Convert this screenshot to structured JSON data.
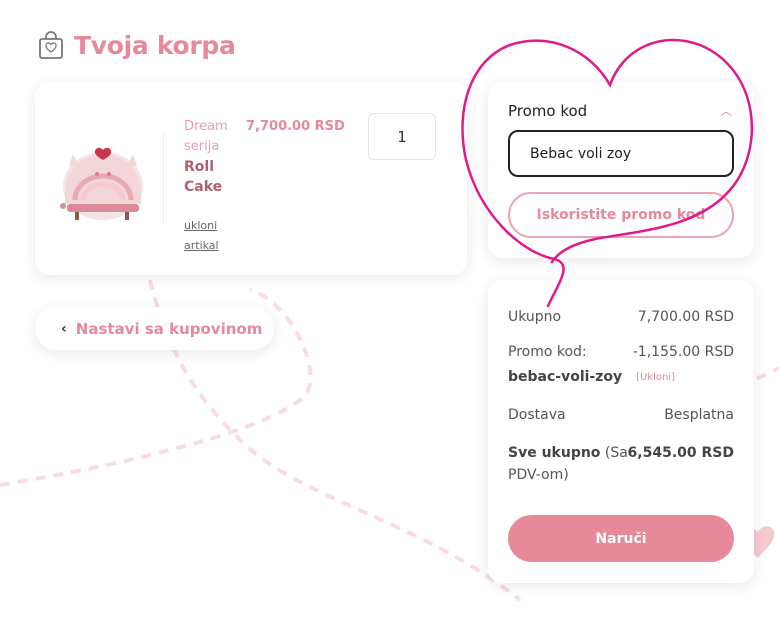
{
  "page": {
    "title": "Tvoja korpa"
  },
  "cart": {
    "items": [
      {
        "series": "Dream serija",
        "name": "Roll Cake",
        "remove_label": "ukloni artikal",
        "price": "7,700.00 RSD",
        "quantity": "1"
      }
    ],
    "continue_label": "Nastavi sa kupovinom"
  },
  "promo": {
    "title": "Promo kod",
    "input_value": "Bebac voli zoy",
    "apply_label": "Iskoristite promo kod"
  },
  "summary": {
    "subtotal_label": "Ukupno",
    "subtotal_value": "7,700.00 RSD",
    "promo_label": "Promo kod:",
    "promo_code": "bebac-voli-zoy",
    "promo_value": "-1,155.00 RSD",
    "promo_remove": "[Ukloni]",
    "shipping_label": "Dostava",
    "shipping_value": "Besplatna",
    "total_label_bold": "Sve ukupno",
    "total_label_rest": " (Sa PDV-om)",
    "total_value": "6,545.00 RSD",
    "order_label": "Naruči"
  },
  "colors": {
    "accent": "#e6899a",
    "annotation": "#e0198c"
  }
}
